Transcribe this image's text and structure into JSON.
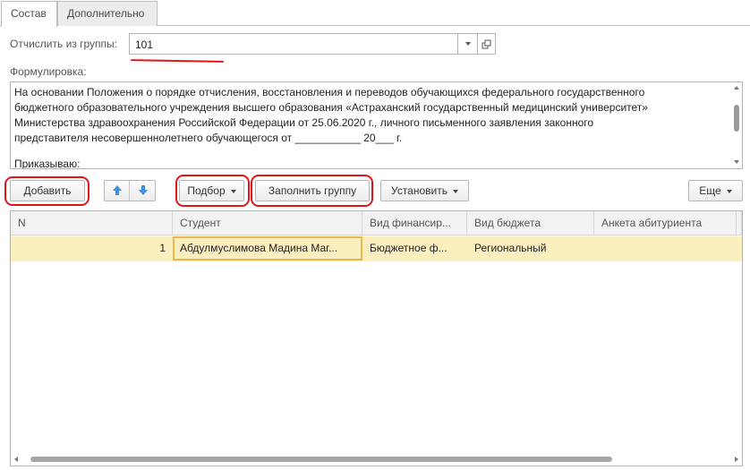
{
  "tabs": [
    "Состав",
    "Дополнительно"
  ],
  "group_field": {
    "label": "Отчислить из группы:",
    "value": "101"
  },
  "wording": {
    "label": "Формулировка:",
    "lines": [
      "На основании Положения о порядке отчисления, восстановления и переводов обучающихся федерального государственного",
      "бюджетного образовательного учреждения высшего образования «Астраханский государственный медицинский университет»",
      "Министерства здравоохранения Российской Федерации от 25.06.2020 г., личного письменного заявления  законного",
      "представителя  несовершеннолетнего обучающегося от ___________ 20___ г.",
      "",
      "Приказываю:"
    ]
  },
  "toolbar": {
    "add": "Добавить",
    "select": "Подбор",
    "fill_group": "Заполнить группу",
    "set": "Установить",
    "more": "Еще"
  },
  "table": {
    "columns": [
      "N",
      "Студент",
      "Вид финансир...",
      "Вид бюджета",
      "Анкета абитуриента"
    ],
    "rows": [
      {
        "n": "1",
        "student": "Абдулмуслимова Мадина Маг...",
        "finance": "Бюджетное ф...",
        "budget": "Региональный",
        "form": ""
      }
    ]
  },
  "colors": {
    "selected_row": "#fbefbf",
    "active_cell_border": "#e8b84a",
    "annotation": "#e0151b",
    "arrow_icon": "#3f8fe0"
  }
}
